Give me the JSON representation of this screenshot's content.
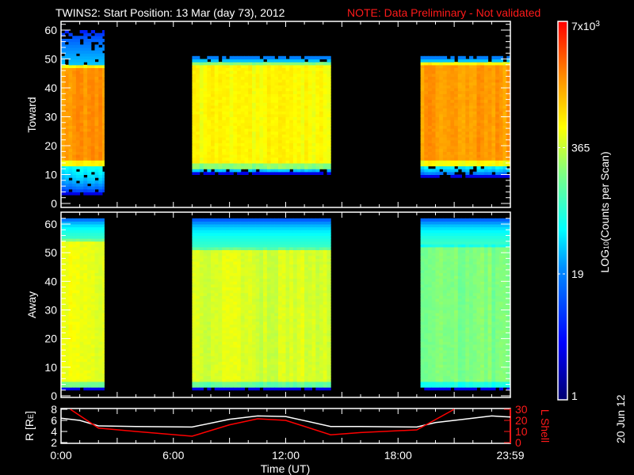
{
  "title": {
    "main": "TWINS2: Start Position: 13 Mar (day  73), 2012",
    "note": "NOTE: Data Preliminary - Not validated",
    "note_color": "#ff0000"
  },
  "footer_date": "20 Jun 12",
  "chart_data": [
    {
      "type": "heatmap",
      "panel": "toward",
      "ylabel": "Toward",
      "ylim": [
        0,
        63
      ],
      "yticks": [
        "0",
        "10",
        "20",
        "30",
        "40",
        "50",
        "60"
      ],
      "xlim_hours": [
        0,
        24
      ],
      "segments": [
        {
          "t0": 0.0,
          "t1": 2.3,
          "core": [
            13,
            48
          ],
          "core_counts": 1800,
          "upper_edge": [
            48,
            60
          ],
          "lower_edge": [
            3,
            13
          ]
        },
        {
          "t0": 7.0,
          "t1": 14.4,
          "core": [
            12,
            49
          ],
          "core_counts": 600,
          "upper_edge": [
            49,
            51
          ],
          "lower_edge": [
            10,
            12
          ]
        },
        {
          "t0": 19.2,
          "t1": 24.0,
          "core": [
            13,
            49
          ],
          "core_counts": 1700,
          "upper_edge": [
            49,
            51
          ],
          "lower_edge": [
            9,
            13
          ]
        }
      ]
    },
    {
      "type": "heatmap",
      "panel": "away",
      "ylabel": "Away",
      "ylim": [
        0,
        63
      ],
      "yticks": [
        "0",
        "10",
        "20",
        "30",
        "40",
        "50",
        "60"
      ],
      "xlim_hours": [
        0,
        24
      ],
      "segments": [
        {
          "t0": 0.0,
          "t1": 2.3,
          "core": [
            3,
            55
          ],
          "core_counts": 500,
          "upper_edge": [
            55,
            62
          ],
          "lower_edge": [
            2,
            3
          ]
        },
        {
          "t0": 7.0,
          "t1": 14.4,
          "core": [
            3,
            52
          ],
          "core_counts": 420,
          "upper_edge": [
            52,
            62
          ],
          "lower_edge": [
            2,
            3
          ]
        },
        {
          "t0": 19.2,
          "t1": 24.0,
          "core": [
            3,
            53
          ],
          "core_counts": 200,
          "upper_edge": [
            53,
            62
          ],
          "lower_edge": [
            2,
            3
          ]
        }
      ]
    },
    {
      "type": "line",
      "panel": "orbit",
      "ylabel_left": "R [R",
      "ylabel_left_sub": "E",
      "ylabel_left_end": "]",
      "ylabel_right": "L Shell",
      "ylim_left": [
        2,
        8
      ],
      "ylim_right": [
        0,
        30
      ],
      "yticks_left": [
        "2",
        "4",
        "6",
        "8"
      ],
      "yticks_right": [
        "0",
        "10",
        "20",
        "30"
      ],
      "xlabel": "Time (UT)",
      "xticks": [
        "0:00",
        "6:00",
        "12:00",
        "18:00",
        "23:59"
      ],
      "series": [
        {
          "name": "R",
          "color": "#ffffff",
          "axis": "left",
          "x": [
            0,
            1,
            2,
            4,
            7,
            9,
            10.5,
            12,
            14.4,
            16,
            19,
            20,
            21.5,
            23,
            24
          ],
          "y": [
            6.4,
            6.0,
            5.0,
            4.9,
            4.8,
            6.2,
            6.8,
            6.7,
            4.9,
            4.9,
            4.8,
            5.6,
            6.2,
            6.8,
            6.6
          ]
        },
        {
          "name": "L Shell",
          "color": "#ff0000",
          "axis": "right",
          "x": [
            0.5,
            2,
            4,
            7,
            9,
            10.5,
            12,
            14.4,
            16,
            19,
            21
          ],
          "y": [
            30,
            13,
            10,
            5.7,
            16,
            21.4,
            20,
            7,
            9,
            11.4,
            30
          ]
        }
      ]
    }
  ],
  "colorbar": {
    "label": "LOG",
    "label_sub": "10",
    "label_end": "(Counts per Scan)",
    "max": 7000,
    "min": 1,
    "ticks": [
      {
        "value": 7000,
        "label": "7x10",
        "sup": "3"
      },
      {
        "value": 365,
        "label": "365"
      },
      {
        "value": 19,
        "label": "19"
      },
      {
        "value": 1,
        "label": "1"
      }
    ]
  }
}
